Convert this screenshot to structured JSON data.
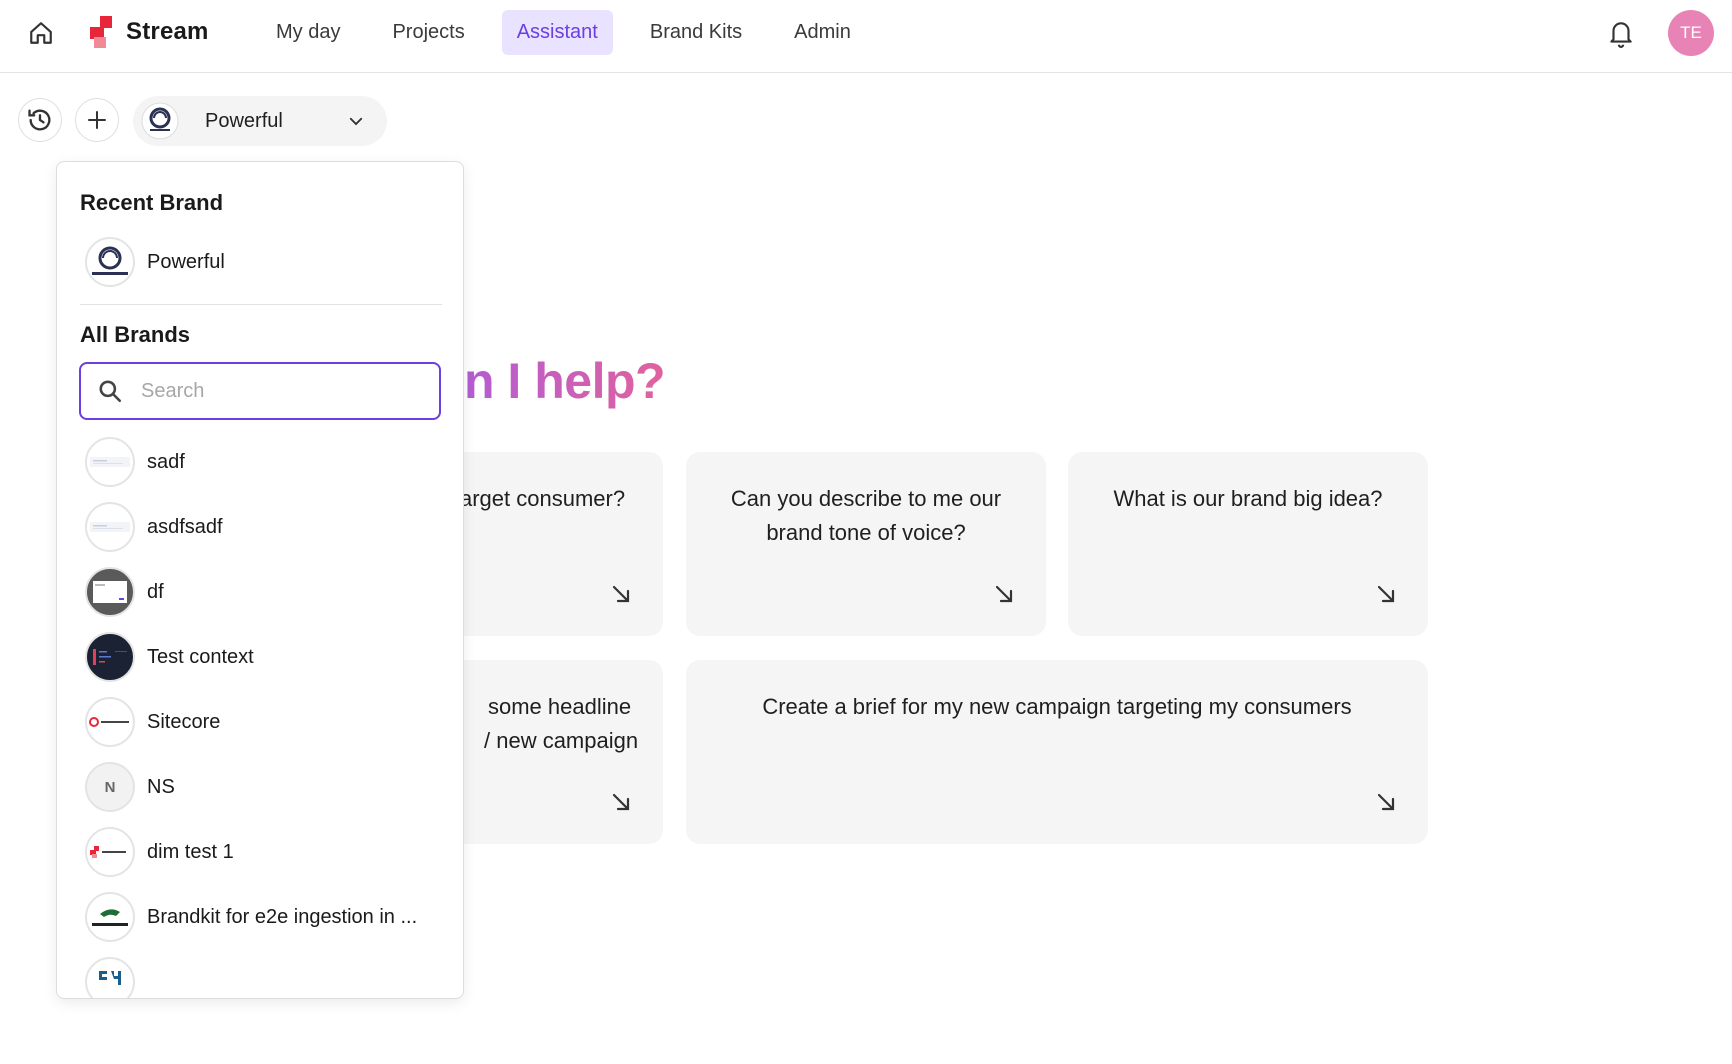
{
  "app": {
    "name": "Stream"
  },
  "nav": {
    "items": [
      {
        "label": "My day"
      },
      {
        "label": "Projects"
      },
      {
        "label": "Assistant"
      },
      {
        "label": "Brand Kits"
      },
      {
        "label": "Admin"
      }
    ],
    "active": "Assistant"
  },
  "user": {
    "initials": "TE",
    "avatar_color": "#e883b6"
  },
  "toolbar": {
    "brand_select_label": "Powerful"
  },
  "hero": {
    "visible_text": "n I help?"
  },
  "cards": [
    {
      "text": "arget consumer?"
    },
    {
      "text": "Can you describe to me our brand tone of voice?"
    },
    {
      "text": "What is our brand big idea?"
    },
    {
      "line1": "some headline",
      "line2": "/ new campaign"
    },
    {
      "text": "Create a brief for my new campaign targeting my consumers"
    }
  ],
  "dropdown": {
    "recent_heading": "Recent Brand",
    "recent": [
      {
        "name": "Powerful",
        "logo": "powerful-logo"
      }
    ],
    "all_heading": "All Brands",
    "search_placeholder": "Search",
    "brands": [
      {
        "name": "sadf",
        "logo": "thumbnail-light"
      },
      {
        "name": "asdfsadf",
        "logo": "thumbnail-light"
      },
      {
        "name": "df",
        "logo": "thumbnail-screen"
      },
      {
        "name": "Test context",
        "logo": "thumbnail-dark"
      },
      {
        "name": "Sitecore",
        "logo": "sitecore-logo"
      },
      {
        "name": "NS",
        "logo": "initial",
        "initial": "N"
      },
      {
        "name": "dim test 1",
        "logo": "stream-logo"
      },
      {
        "name": "Brandkit for e2e ingestion in ...",
        "logo": "lacoste-logo"
      }
    ]
  },
  "colors": {
    "accent": "#6b3fe0",
    "accent_bg": "#e9e3ff",
    "card_bg": "#f5f5f5",
    "brand_red": "#e8263a"
  }
}
